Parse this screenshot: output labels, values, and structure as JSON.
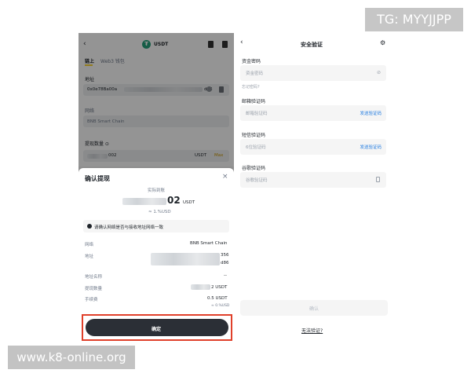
{
  "overlays": {
    "tg": "TG: MYYJJPP",
    "site": "www.k8-online.org"
  },
  "left": {
    "header_title": "USDT",
    "tabs": [
      "链上",
      "Web3 钱包"
    ],
    "address_label": "地址",
    "address_value": "0x0e78Ba00a",
    "address_end": "d86",
    "network_label": "网络",
    "network_value": "BNB Smart Chain",
    "amount_label": "提现数量 ⊙",
    "amount_value": "002",
    "amount_unit": "USDT",
    "max_label": "Max",
    "sheet": {
      "title": "确认提现",
      "received_label": "实际到账",
      "amount_big": "02",
      "amount_unit": "USDT",
      "approx": "≈ 1.%USD",
      "notice": "请确认网络是否与接收地址网络一致",
      "details": [
        {
          "label": "网络",
          "value": "BNB Smart Chain"
        },
        {
          "label": "地址",
          "value": "356"
        },
        {
          "label": "",
          "value": "d86"
        },
        {
          "label": "地址名称",
          "value": "--"
        },
        {
          "label": "提现数量",
          "value": "2 USDT"
        },
        {
          "label": "手续费",
          "value": "0.5 USDT"
        },
        {
          "label": "",
          "value": "≈ 0.%USD"
        }
      ],
      "confirm_label": "确定"
    }
  },
  "right": {
    "title": "安全验证",
    "fund_password_label": "资金密码",
    "fund_password_placeholder": "资金密码",
    "forgot_label": "忘记密码?",
    "email_code_label": "邮箱验证码",
    "email_code_placeholder": "邮箱验证码",
    "send_code_label": "发送验证码",
    "sms_code_label": "短信验证码",
    "sms_code_placeholder": "6位验证码",
    "sms_send_label": "发送验证码",
    "google_code_label": "谷歌验证码",
    "google_code_placeholder": "谷歌验证码",
    "confirm_label": "确认",
    "unable_label": "无法验证?"
  },
  "colors": {
    "accent_gold": "#fcd535",
    "link_blue": "#1f7ae0",
    "confirm_dark": "#2b2f36",
    "highlight_red": "#e0402a",
    "usdt_green": "#26a17b"
  }
}
